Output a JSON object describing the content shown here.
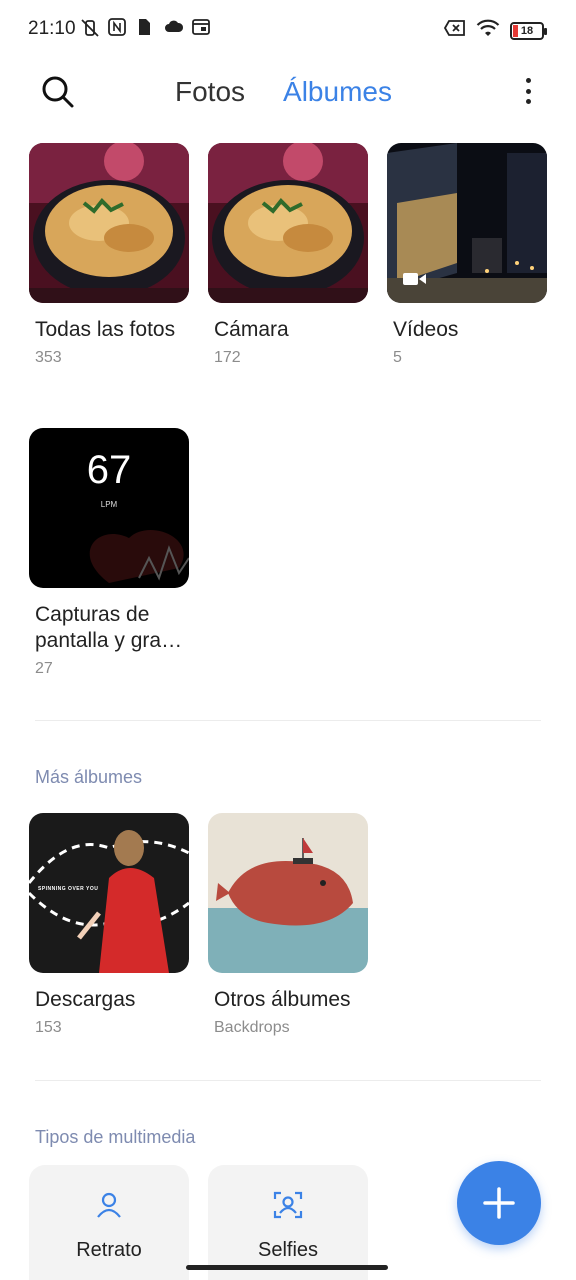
{
  "status": {
    "time": "21:10",
    "battery": "18",
    "icons_left": [
      "mute-vibrate-icon",
      "nfc-icon",
      "sim-icon",
      "cloud-icon",
      "window-icon"
    ],
    "icons_right": [
      "no-sim-icon",
      "wifi-icon",
      "battery-icon"
    ]
  },
  "header": {
    "tabs": [
      {
        "label": "Fotos"
      },
      {
        "label": "Álbumes"
      }
    ],
    "accent": "#3b82e6"
  },
  "albums": [
    {
      "title": "Todas las fotos",
      "count": "353"
    },
    {
      "title": "Cámara",
      "count": "172"
    },
    {
      "title": "Vídeos",
      "count": "5"
    },
    {
      "title": "Capturas de pantalla y gra…",
      "count": "27",
      "thumb_text": "67",
      "thumb_sub": "LPM"
    }
  ],
  "more_albums": {
    "title": "Más álbumes",
    "items": [
      {
        "title": "Descargas",
        "count": "153",
        "thumb_text": "SPINNING OVER YOU"
      },
      {
        "title": "Otros álbumes",
        "count": "Backdrops"
      }
    ]
  },
  "media_types": {
    "title": "Tipos de multimedia",
    "items": [
      {
        "label": "Retrato",
        "icon": "portrait-icon"
      },
      {
        "label": "Selfies",
        "icon": "selfie-icon"
      }
    ]
  }
}
